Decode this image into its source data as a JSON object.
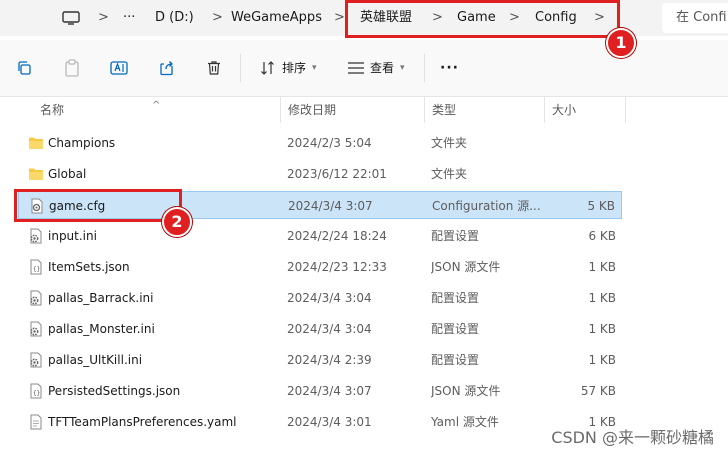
{
  "address": {
    "crumbs": [
      "D (D:)",
      "WeGameApps",
      "英雄联盟",
      "Game",
      "Config"
    ],
    "separator": ">",
    "overflow": "···",
    "search_placeholder": "在 Confi"
  },
  "toolbar": {
    "sort_label": "排序",
    "view_label": "查看",
    "more": "···"
  },
  "columns": {
    "name": "名称",
    "modified": "修改日期",
    "type": "类型",
    "size": "大小"
  },
  "files": [
    {
      "name": "Champions",
      "modified": "2024/2/3 5:04",
      "type": "文件夹",
      "size": "",
      "icon": "folder-icon"
    },
    {
      "name": "Global",
      "modified": "2023/6/12 22:01",
      "type": "文件夹",
      "size": "",
      "icon": "folder-icon"
    },
    {
      "name": "game.cfg",
      "modified": "2024/3/4 3:07",
      "type": "Configuration 源...",
      "size": "5 KB",
      "icon": "config-file-icon",
      "selected": true
    },
    {
      "name": "input.ini",
      "modified": "2024/2/24 18:24",
      "type": "配置设置",
      "size": "6 KB",
      "icon": "settings-file-icon"
    },
    {
      "name": "ItemSets.json",
      "modified": "2024/2/23 12:33",
      "type": "JSON 源文件",
      "size": "1 KB",
      "icon": "json-file-icon"
    },
    {
      "name": "pallas_Barrack.ini",
      "modified": "2024/3/4 3:04",
      "type": "配置设置",
      "size": "1 KB",
      "icon": "settings-file-icon"
    },
    {
      "name": "pallas_Monster.ini",
      "modified": "2024/3/4 3:04",
      "type": "配置设置",
      "size": "1 KB",
      "icon": "settings-file-icon"
    },
    {
      "name": "pallas_UltKill.ini",
      "modified": "2024/3/4 2:39",
      "type": "配置设置",
      "size": "1 KB",
      "icon": "settings-file-icon"
    },
    {
      "name": "PersistedSettings.json",
      "modified": "2024/3/4 3:07",
      "type": "JSON 源文件",
      "size": "57 KB",
      "icon": "json-file-icon"
    },
    {
      "name": "TFTTeamPlansPreferences.yaml",
      "modified": "2024/3/4 3:01",
      "type": "Yaml 源文件",
      "size": "1 KB",
      "icon": "text-file-icon"
    }
  ],
  "annotations": {
    "badge1": "1",
    "badge2": "2",
    "color": "#e02020"
  },
  "watermark": "CSDN @来一颗砂糖橘",
  "colors": {
    "selection": "#cce4f7",
    "selection_border": "#99c9ef",
    "folder": "#f8c946",
    "accent": "#0067c0"
  }
}
